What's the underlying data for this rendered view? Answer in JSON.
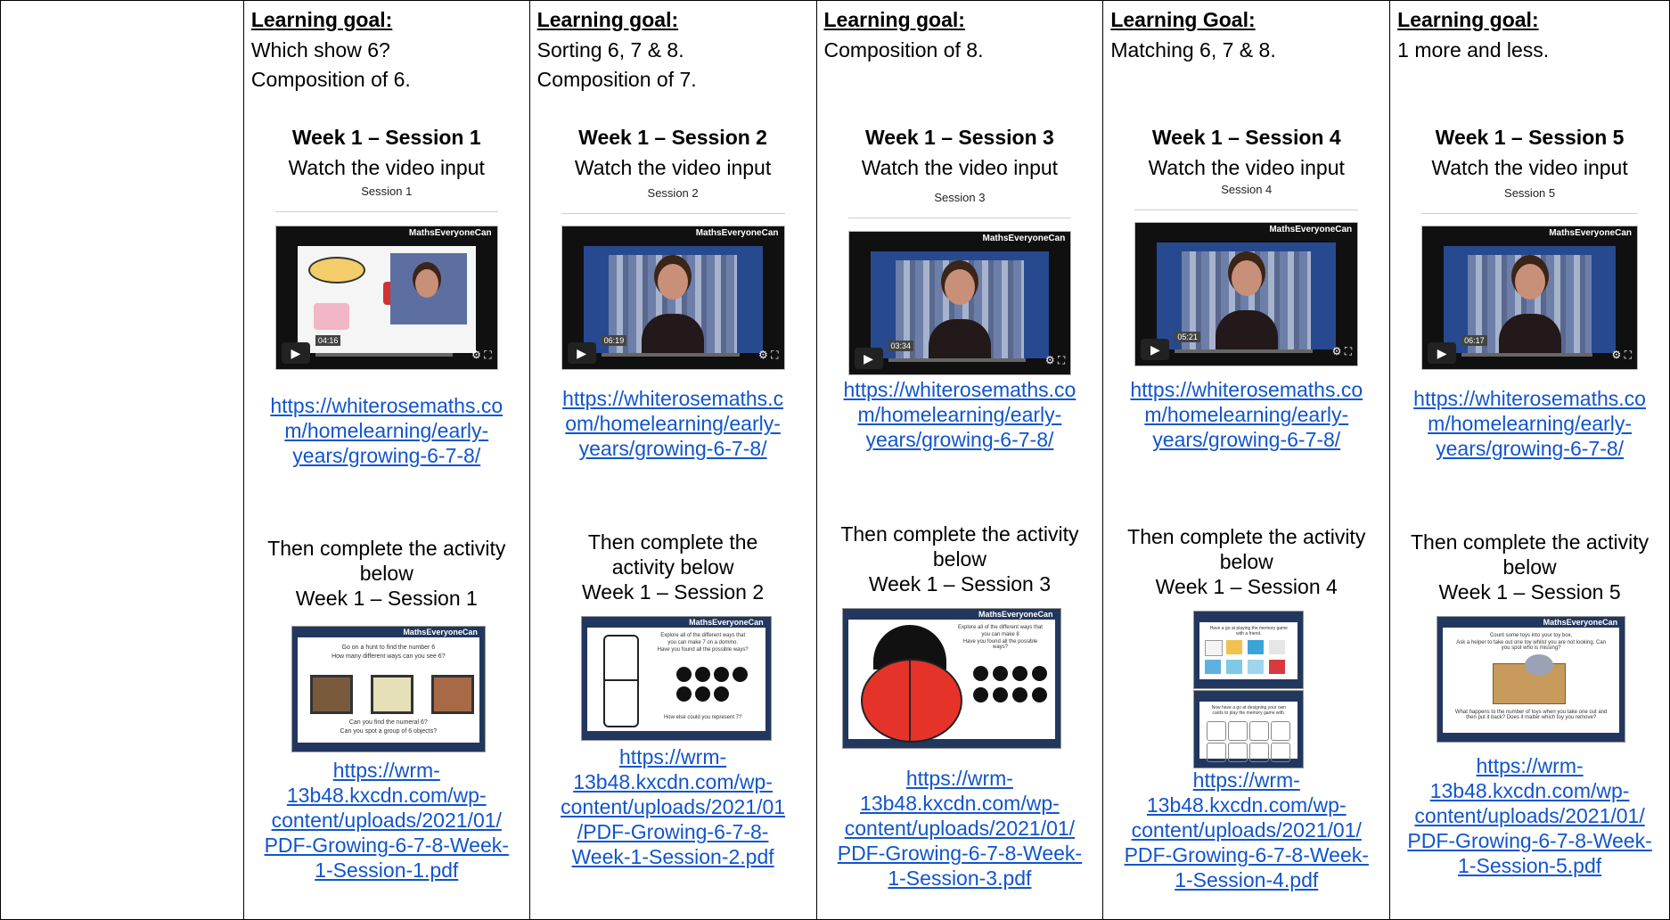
{
  "learning_goal_label": "Learning goal:",
  "learning_goal_label_alt": "Learning Goal:",
  "watch_text": "Watch the video input",
  "then_text_full": "Then complete the activity below",
  "video_brand": "MathsEveryoneCan",
  "sessions": [
    {
      "goal_lines": [
        "Which show 6?",
        "Composition of 6."
      ],
      "title": "Week 1 – Session 1",
      "caption": "Session 1",
      "video_time": "04:16",
      "video_link_lines": [
        "https://whiterosemaths.co",
        "m/homelearning/early-",
        "years/growing-6-7-8/"
      ],
      "then_lines": [
        "Then complete the activity",
        "below",
        "Week 1 – Session 1"
      ],
      "activity_lines": [
        "Go on a hunt to find the number 6",
        "How many different ways can you see 6?",
        "Can you find the numeral 6?",
        "Can you spot a group of 6 objects?"
      ],
      "pdf_link_lines": [
        "https://wrm-",
        "13b48.kxcdn.com/wp-",
        "content/uploads/2021/01/",
        "PDF-Growing-6-7-8-Week-",
        "1-Session-1.pdf"
      ]
    },
    {
      "goal_lines": [
        "Sorting 6, 7 & 8.",
        "Composition of 7."
      ],
      "title": "Week 1 – Session 2",
      "caption": "Session 2",
      "video_time": "06:19",
      "video_link_lines": [
        "https://whiterosemaths.c",
        "om/homelearning/early-",
        "years/growing-6-7-8/"
      ],
      "then_lines": [
        "Then complete the",
        "activity below",
        "Week 1 – Session 2"
      ],
      "activity_lines": [
        "Explore all of the different ways that",
        "you can make 7 on a domino.",
        "Have you found all the possible ways?",
        "How else could you represent 7?"
      ],
      "pdf_link_lines": [
        "https://wrm-",
        "13b48.kxcdn.com/wp-",
        "content/uploads/2021/01",
        "/PDF-Growing-6-7-8-",
        "Week-1-Session-2.pdf"
      ]
    },
    {
      "goal_lines": [
        "Composition of 8."
      ],
      "title": "Week 1 – Session 3",
      "caption": "Session 3",
      "video_time": "03:34",
      "video_link_lines": [
        "https://whiterosemaths.co",
        "m/homelearning/early-",
        "years/growing-6-7-8/"
      ],
      "then_lines": [
        "Then complete the activity",
        "below",
        "Week 1 – Session 3"
      ],
      "activity_lines": [
        "Explore all of the different ways that",
        "you can make 8",
        "Have you found all the possible ways?"
      ],
      "pdf_link_lines": [
        "https://wrm-",
        "13b48.kxcdn.com/wp-",
        "content/uploads/2021/01/",
        "PDF-Growing-6-7-8-Week-",
        "1-Session-3.pdf"
      ]
    },
    {
      "goal_lines": [
        "Matching 6, 7 & 8."
      ],
      "title": "Week 1 – Session 4",
      "caption": "Session 4",
      "video_time": "05:21",
      "video_link_lines": [
        "https://whiterosemaths.co",
        "m/homelearning/early-",
        "years/growing-6-7-8/"
      ],
      "then_lines": [
        "Then complete the activity",
        "below",
        "Week 1 – Session 4"
      ],
      "activity_lines": [
        "Have a go at playing the memory game with a friend.",
        "Now have a go at designing your own cards to play the memory game with."
      ],
      "pdf_link_lines": [
        "https://wrm-",
        "13b48.kxcdn.com/wp-",
        "content/uploads/2021/01/",
        "PDF-Growing-6-7-8-Week-",
        "1-Session-4.pdf"
      ]
    },
    {
      "goal_lines": [
        "1 more and less."
      ],
      "title": "Week 1 – Session 5",
      "caption": "Session 5",
      "video_time": "06:17",
      "video_link_lines": [
        "https://whiterosemaths.co",
        "m/homelearning/early-",
        "years/growing-6-7-8/"
      ],
      "then_lines": [
        "Then complete the activity",
        "below",
        "Week 1 – Session 5"
      ],
      "activity_lines": [
        "Count some toys into your toy box.",
        "Ask a helper to take out one toy whilst you are not looking. Can you spot who is missing?",
        "What happens to the number of toys when you take one out and then put it back? Does it matter which toy you remove?"
      ],
      "pdf_link_lines": [
        "https://wrm-",
        "13b48.kxcdn.com/wp-",
        "content/uploads/2021/01/",
        "PDF-Growing-6-7-8-Week-",
        "1-Session-5.pdf"
      ]
    }
  ]
}
